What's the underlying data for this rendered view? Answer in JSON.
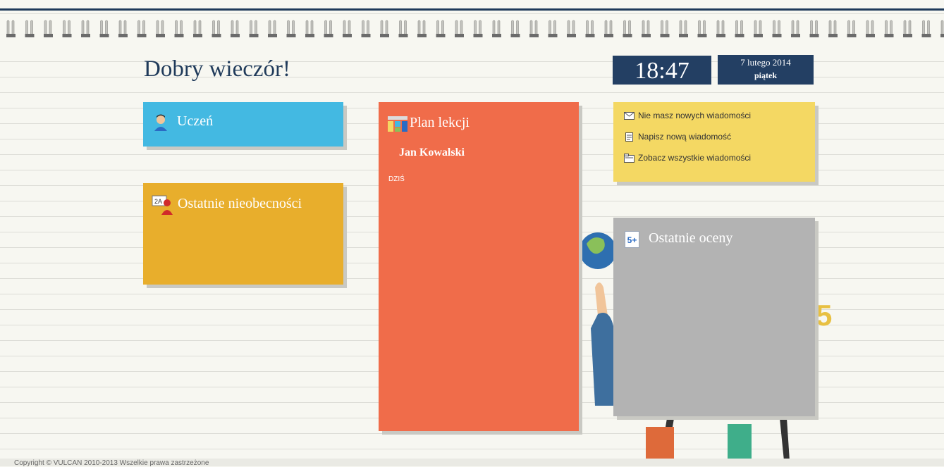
{
  "greeting": "Dobry wieczór!",
  "clock": {
    "time": "18:47",
    "date": "7 lutego 2014",
    "weekday": "piątek"
  },
  "tiles": {
    "student": {
      "title": "Uczeń",
      "icon": "student-icon"
    },
    "absences": {
      "title": "Ostatnie nieobecności",
      "icon": "absence-icon"
    },
    "schedule": {
      "title": "Plan lekcji",
      "icon": "schedule-icon",
      "student_name": "Jan Kowalski",
      "today_label": "DZIŚ"
    },
    "messages": {
      "items": [
        {
          "label": "Nie masz nowych wiadomości",
          "icon": "envelope-icon"
        },
        {
          "label": "Napisz nową wiadomość",
          "icon": "compose-icon"
        },
        {
          "label": "Zobacz wszystkie wiadomości",
          "icon": "folder-icon"
        }
      ]
    },
    "grades": {
      "title": "Ostatnie oceny",
      "icon_text": "5+"
    }
  },
  "decor": {
    "big_digit": "5"
  },
  "footer": {
    "copyright": "Copyright © VULCAN 2010-2013 Wszelkie prawa zastrzeżone"
  },
  "colors": {
    "student": "#43b9e2",
    "absences": "#e8ae2c",
    "schedule": "#f06c4a",
    "messages": "#f4d863",
    "grades": "#b3b3b3",
    "header": "#233f63"
  }
}
